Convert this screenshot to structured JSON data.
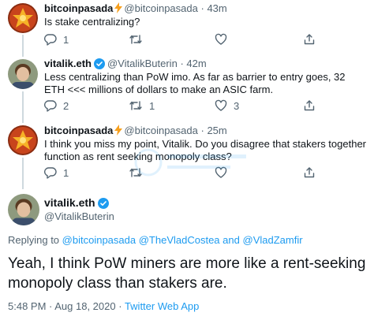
{
  "tweets": [
    {
      "name": "bitcoinpasada",
      "handle": "@bitcoinpasada",
      "sep": "·",
      "time": "43m",
      "text": "Is stake centralizing?",
      "replies": "1",
      "retweets": "",
      "likes": ""
    },
    {
      "name": "vitalik.eth",
      "handle": "@VitalikButerin",
      "sep": "·",
      "time": "42m",
      "text": "Less centralizing than PoW imo. As far as barrier to entry goes, 32 ETH <<< millions of dollars to make an ASIC farm.",
      "replies": "2",
      "retweets": "1",
      "likes": "3"
    },
    {
      "name": "bitcoinpasada",
      "handle": "@bitcoinpasada",
      "sep": "·",
      "time": "25m",
      "text": "I think you miss my point, Vitalik. Do you disagree that stakers together function as rent seeking monopoly class?",
      "replies": "1",
      "retweets": "",
      "likes": ""
    }
  ],
  "main": {
    "name": "vitalik.eth",
    "handle": "@VitalikButerin",
    "replying_prefix": "Replying to",
    "replying_to": [
      "@bitcoinpasada",
      "@TheVladCostea",
      "@VladZamfir"
    ],
    "replying_and": "and",
    "text": "Yeah, I think PoW miners are more like a rent-seeking monopoly class than stakers are.",
    "timestamp": "5:48 PM · Aug 18, 2020 ·",
    "source": "Twitter Web App"
  },
  "icons": {
    "reply": "reply-icon",
    "retweet": "retweet-icon",
    "like": "heart-icon",
    "share": "share-icon",
    "verified": "verified-badge-icon",
    "bolt": "lightning-bolt-icon"
  },
  "colors": {
    "text": "#0f1419",
    "muted": "#536471",
    "link": "#1d9bf0",
    "bolt": "#f7a01e",
    "verified": "#1d9bf0"
  }
}
